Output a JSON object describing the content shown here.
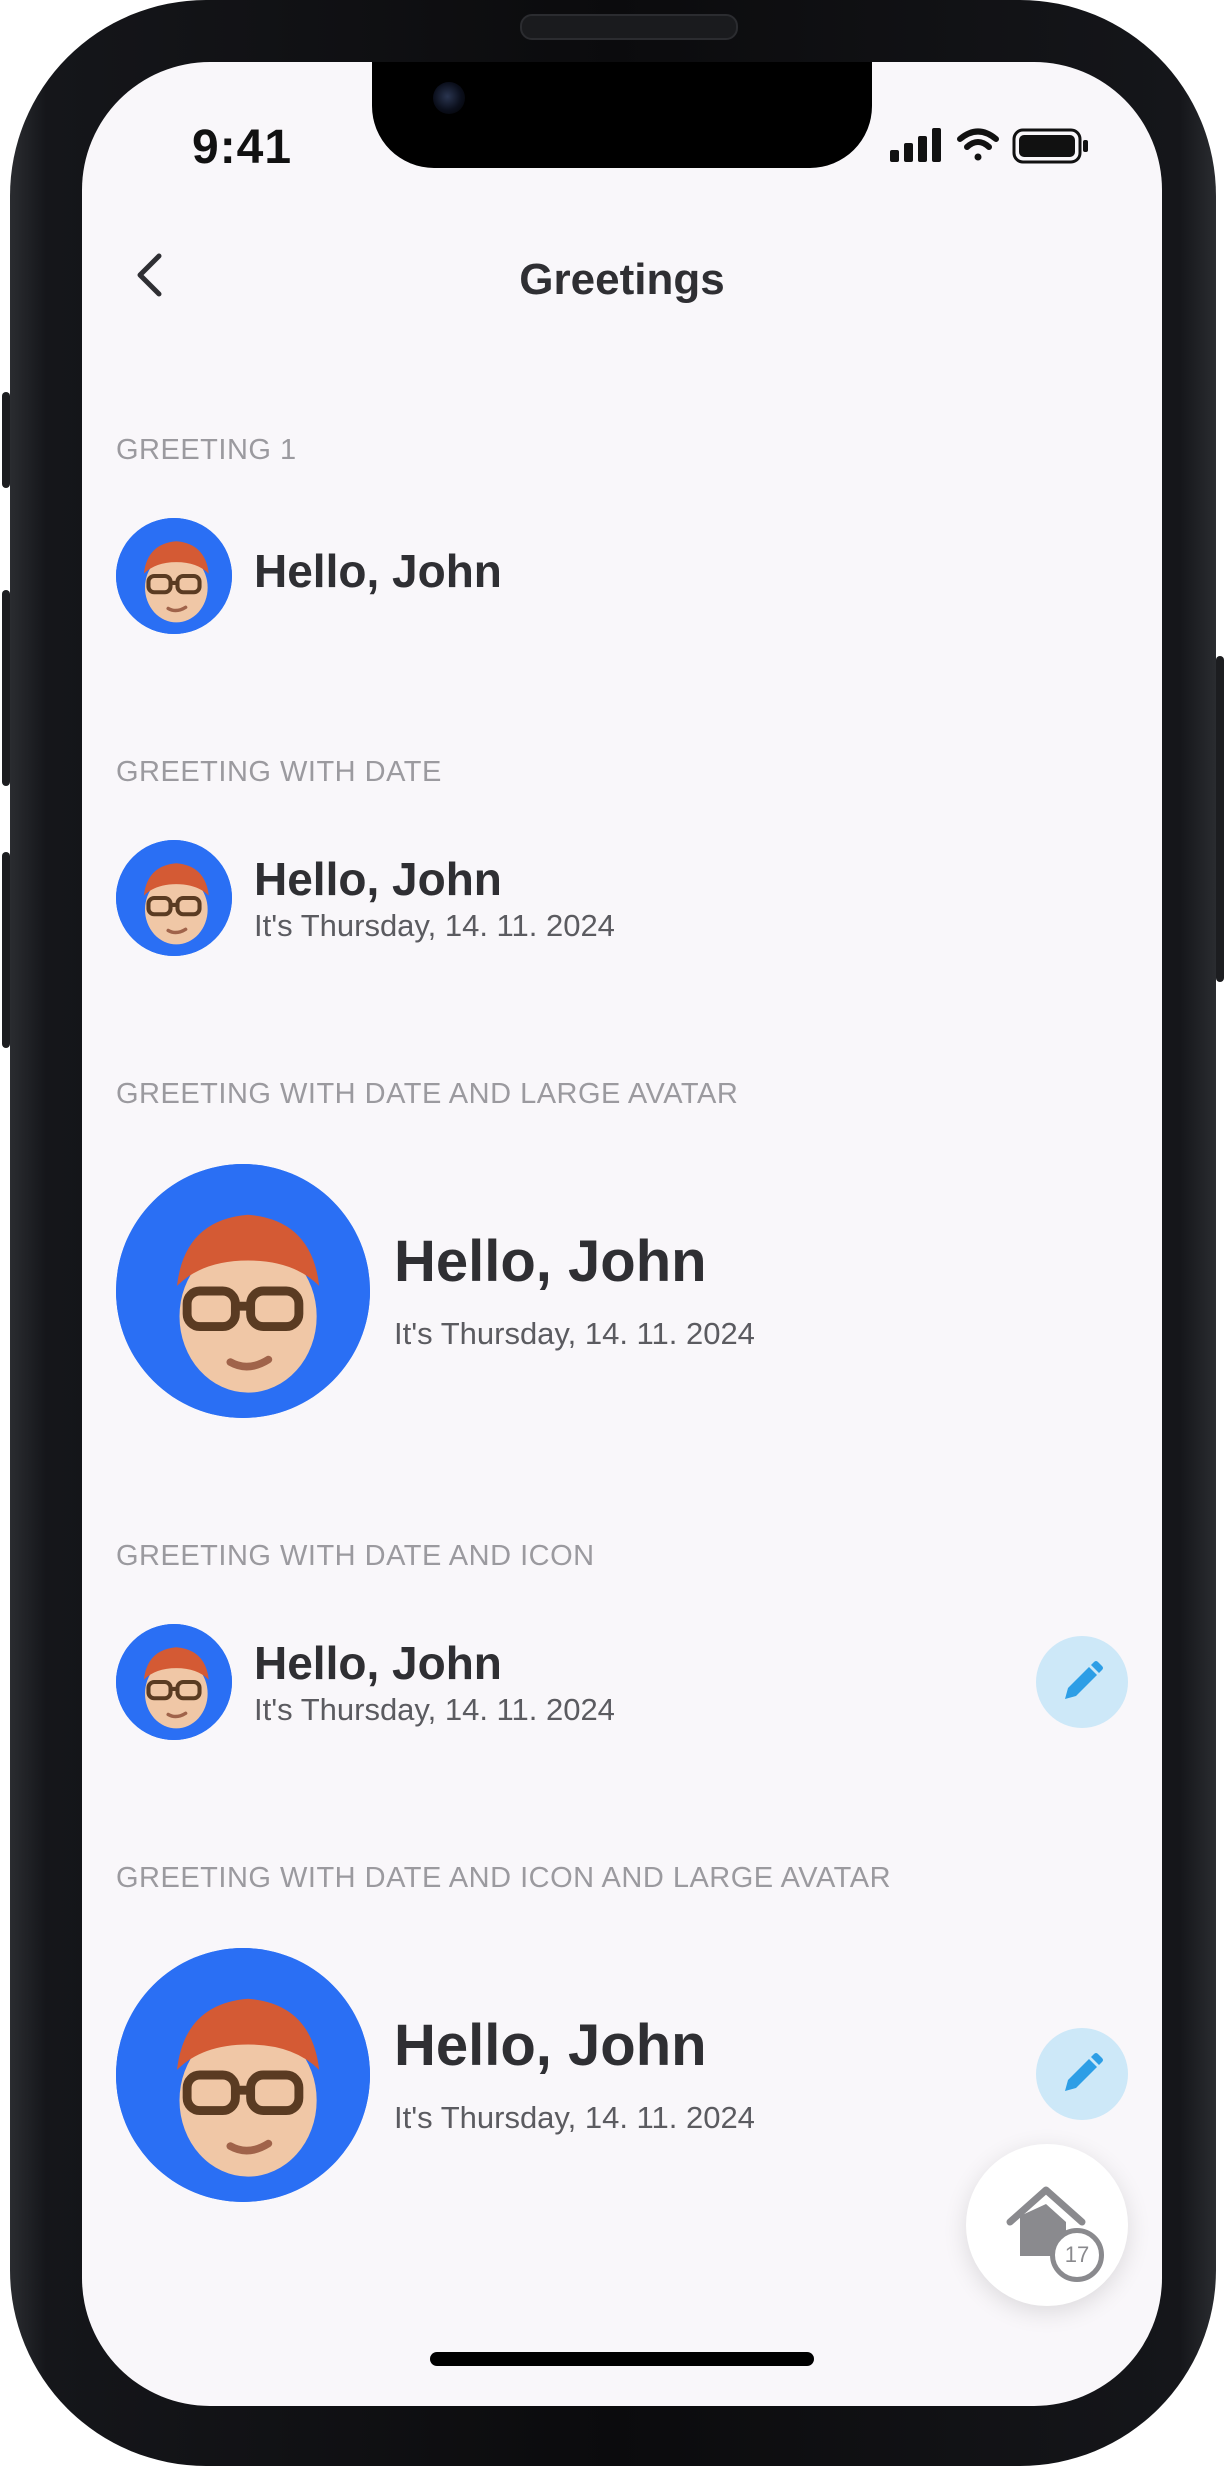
{
  "status_bar": {
    "time": "9:41"
  },
  "nav": {
    "title": "Greetings",
    "back_icon": "chevron-left-icon"
  },
  "colors": {
    "avatar_bg": "#2a6ff4",
    "edit_bg": "#cde8f8",
    "edit_icon": "#2d9ee6",
    "screen_bg": "#f9f7fa"
  },
  "sections": [
    {
      "label": "GREETING 1",
      "title": "Hello, John"
    },
    {
      "label": "GREETING WITH DATE",
      "title": "Hello, John",
      "subtitle": "It's Thursday, 14. 11. 2024"
    },
    {
      "label": "GREETING WITH DATE AND LARGE AVATAR",
      "title": "Hello, John",
      "subtitle": "It's Thursday, 14. 11. 2024"
    },
    {
      "label": "GREETING WITH DATE AND ICON",
      "title": "Hello, John",
      "subtitle": "It's Thursday, 14. 11. 2024",
      "icon": "pencil-icon"
    },
    {
      "label": "GREETING WITH DATE AND ICON AND LARGE AVATAR",
      "title": "Hello, John",
      "subtitle": "It's Thursday, 14. 11. 2024",
      "icon": "pencil-icon"
    }
  ],
  "fab": {
    "icon": "home-icon",
    "badge": "17"
  }
}
